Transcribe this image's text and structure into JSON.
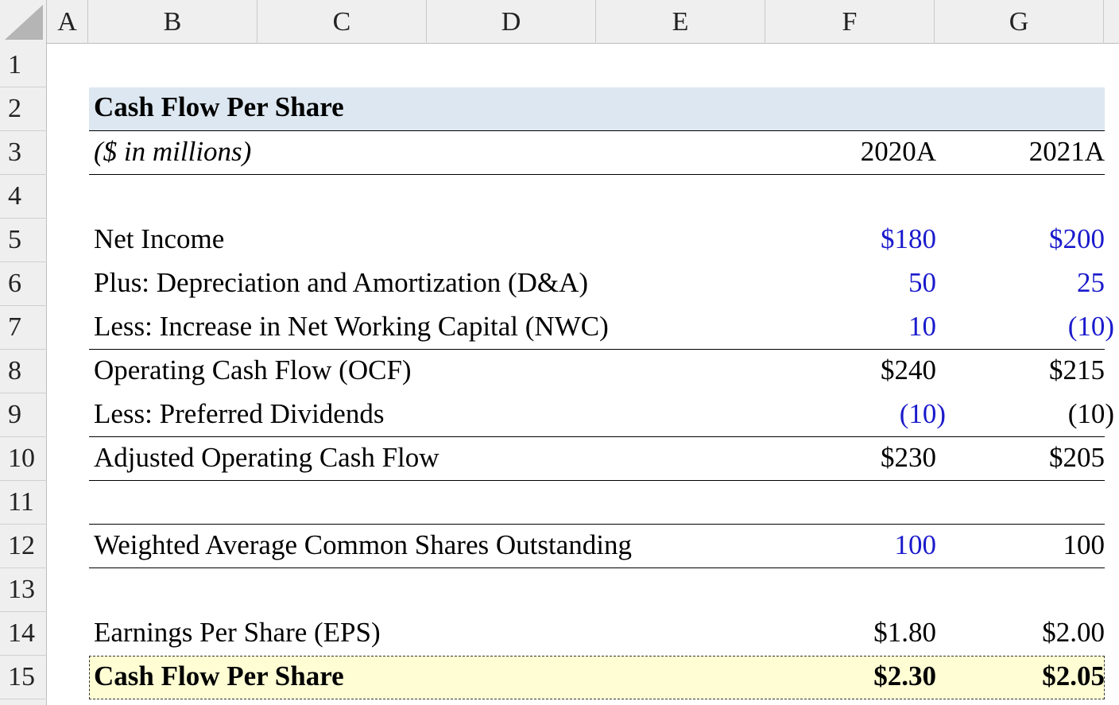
{
  "columns": [
    "A",
    "B",
    "C",
    "D",
    "E",
    "F",
    "G"
  ],
  "rows": [
    "1",
    "2",
    "3",
    "4",
    "5",
    "6",
    "7",
    "8",
    "9",
    "10",
    "11",
    "12",
    "13",
    "14",
    "15"
  ],
  "sheet": {
    "title": "Cash Flow Per Share",
    "units": "($ in millions)",
    "year_f": "2020A",
    "year_g": "2021A",
    "lines": [
      {
        "label": "Net Income",
        "f": "$180",
        "g": "$200",
        "f_color": "blue",
        "g_color": "blue"
      },
      {
        "label": "Plus: Depreciation and Amortization (D&A)",
        "f": "50",
        "g": "25",
        "f_color": "blue",
        "g_color": "blue"
      },
      {
        "label": "Less: Increase in Net Working Capital (NWC)",
        "f": "10",
        "g": "(10)",
        "f_color": "blue",
        "g_color": "blue"
      },
      {
        "label": "Operating Cash Flow (OCF)",
        "f": "$240",
        "g": "$215",
        "f_color": "black",
        "g_color": "black"
      },
      {
        "label": "Less: Preferred Dividends",
        "f": "(10)",
        "g": "(10)",
        "f_color": "blue",
        "g_color": "black"
      },
      {
        "label": "Adjusted Operating Cash Flow",
        "f": "$230",
        "g": "$205",
        "f_color": "black",
        "g_color": "black"
      },
      {
        "label": "Weighted Average Common Shares Outstanding",
        "f": "100",
        "g": "100",
        "f_color": "blue",
        "g_color": "black"
      },
      {
        "label": "Earnings Per Share (EPS)",
        "f": "$1.80",
        "g": "$2.00",
        "f_color": "black",
        "g_color": "black"
      },
      {
        "label": "Cash Flow Per Share",
        "f": "$2.30",
        "g": "$2.05",
        "f_color": "black",
        "g_color": "black"
      }
    ]
  },
  "colors": {
    "input_blue": "#1a1acd",
    "title_band": "#dde7f1",
    "total_band": "#fefdd3",
    "header_gray": "#efefef"
  }
}
